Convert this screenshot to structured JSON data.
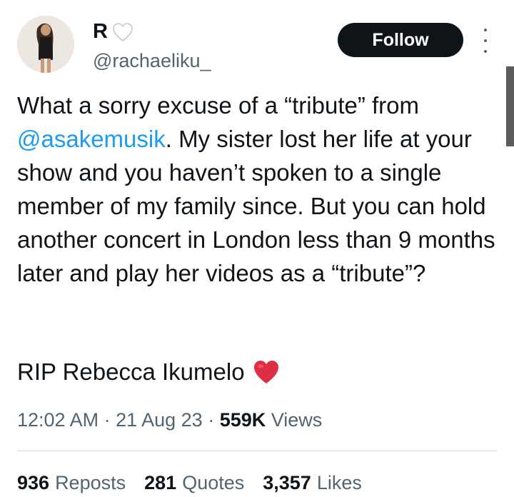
{
  "user": {
    "display_name": "R",
    "name_emoji": "🤍",
    "handle": "@rachaeliku_"
  },
  "follow_label": "Follow",
  "tweet": {
    "text_before_mention": "What a sorry excuse of a “tribute” from ",
    "mention": "@asakemusik",
    "text_after_mention": ". My sister lost her life at your show and you haven’t spoken to a single member of my family since. But you can hold another concert in London less than 9 months later and play her videos as a “tribute”?",
    "second_paragraph": "RIP Rebecca Ikumelo",
    "heart_emoji": "❤️"
  },
  "meta": {
    "time": "12:02 AM",
    "sep1": " · ",
    "date": "21 Aug 23",
    "sep2": " · ",
    "views_count": "559K",
    "views_label": "Views"
  },
  "stats": [
    {
      "count": "936",
      "label": "Reposts"
    },
    {
      "count": "281",
      "label": "Quotes"
    },
    {
      "count": "3,357",
      "label": "Likes"
    }
  ],
  "colors": {
    "link": "#1d9bf0",
    "text": "#0f1419",
    "secondary": "#536471",
    "follow_bg": "#0f1419"
  }
}
